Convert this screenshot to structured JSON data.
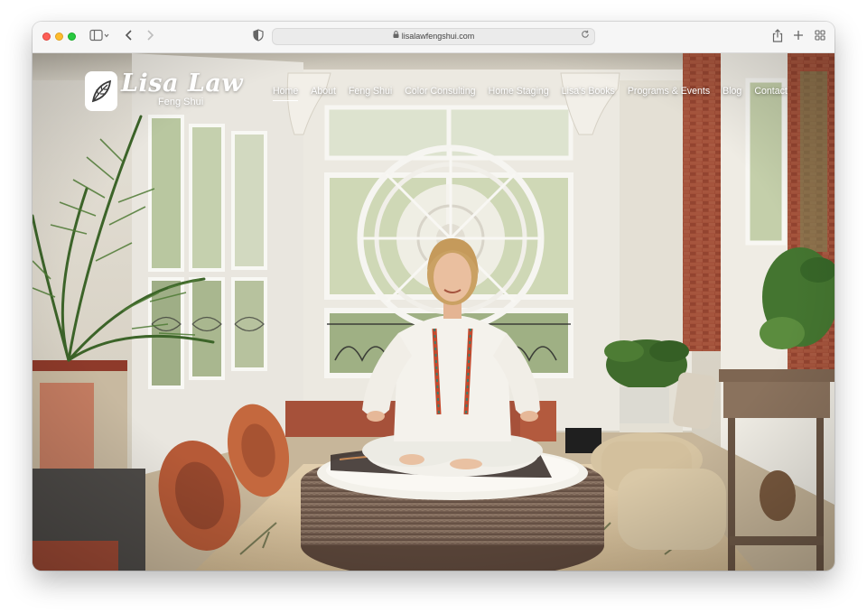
{
  "browser": {
    "url": "lisalawfengshui.com",
    "icons": {
      "sidebar": "sidebar-icon",
      "back": "chevron-left-icon",
      "forward": "chevron-right-icon",
      "privacy": "shield-icon",
      "lock": "lock-icon",
      "reload": "reload-icon",
      "share": "share-icon",
      "new_tab": "plus-icon",
      "tab_overview": "grid-icon"
    }
  },
  "site": {
    "logo": {
      "name": "Lisa Law",
      "subtitle": "Feng Shui"
    },
    "nav": [
      {
        "label": "Home",
        "active": true
      },
      {
        "label": "About",
        "active": false
      },
      {
        "label": "Feng Shui",
        "active": false
      },
      {
        "label": "Color Consulting",
        "active": false
      },
      {
        "label": "Home Staging",
        "active": false
      },
      {
        "label": "Lisa's Books",
        "active": false
      },
      {
        "label": "Programs & Events",
        "active": false
      },
      {
        "label": "Blog",
        "active": false
      },
      {
        "label": "Contact",
        "active": false
      }
    ]
  },
  "colors": {
    "nav_text": "#ffffff",
    "wall": "#ece8df",
    "brick": "#9b4a34",
    "rug": "#d9c4a3",
    "wicker": "#7a6252",
    "cushion_red": "#b0452c",
    "plant_green": "#3f6b2c"
  }
}
